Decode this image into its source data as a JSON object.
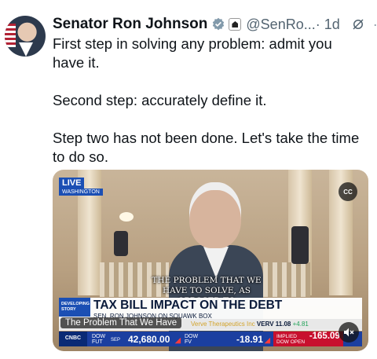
{
  "tweet": {
    "author_name": "Senator Ron Johnson",
    "handle": "@SenRo...",
    "time": "· 1d",
    "more": "···",
    "text_lines": [
      "First step in solving any problem: admit you have it.",
      "Second step: accurately define it.",
      "Step two has not been done. Let's take the time to do so."
    ]
  },
  "video": {
    "live_label": "LIVE",
    "location": "WASHINGTON",
    "cc_label": "CC",
    "caption": "THE PROBLEM THAT WE HAVE TO SOLVE, AS OPPOSED TO",
    "badge": "DEVELOPING STORY",
    "headline": "TAX BILL IMPACT ON THE DEBT",
    "subline": "SEN. RON JOHNSON ON SQUAWK BOX",
    "crawl_title": "The Problem That We Have",
    "crawl_stock_name": "Verve Therapeutics Inc",
    "crawl_stock_sym": "VERV 11.08",
    "crawl_stock_chg": "+4.81",
    "network": "CNBC",
    "t1_label": "DOW FUT",
    "t1_sub": "SEP",
    "t1_val": "42,680.00",
    "t2_label": "DOW FV",
    "t2_val": "-18.91",
    "t3_label": "IMPLIED DOW OPEN",
    "t3_val": "-165.09"
  },
  "colors": {
    "accent": "#1d9bf0",
    "ticker": "#1b3fa0",
    "down": "#ff3b3b"
  },
  "icons": [
    "verified-badge-icon",
    "government-affiliation-icon",
    "grok-icon",
    "more-icon",
    "closed-captions-icon",
    "mute-icon"
  ]
}
